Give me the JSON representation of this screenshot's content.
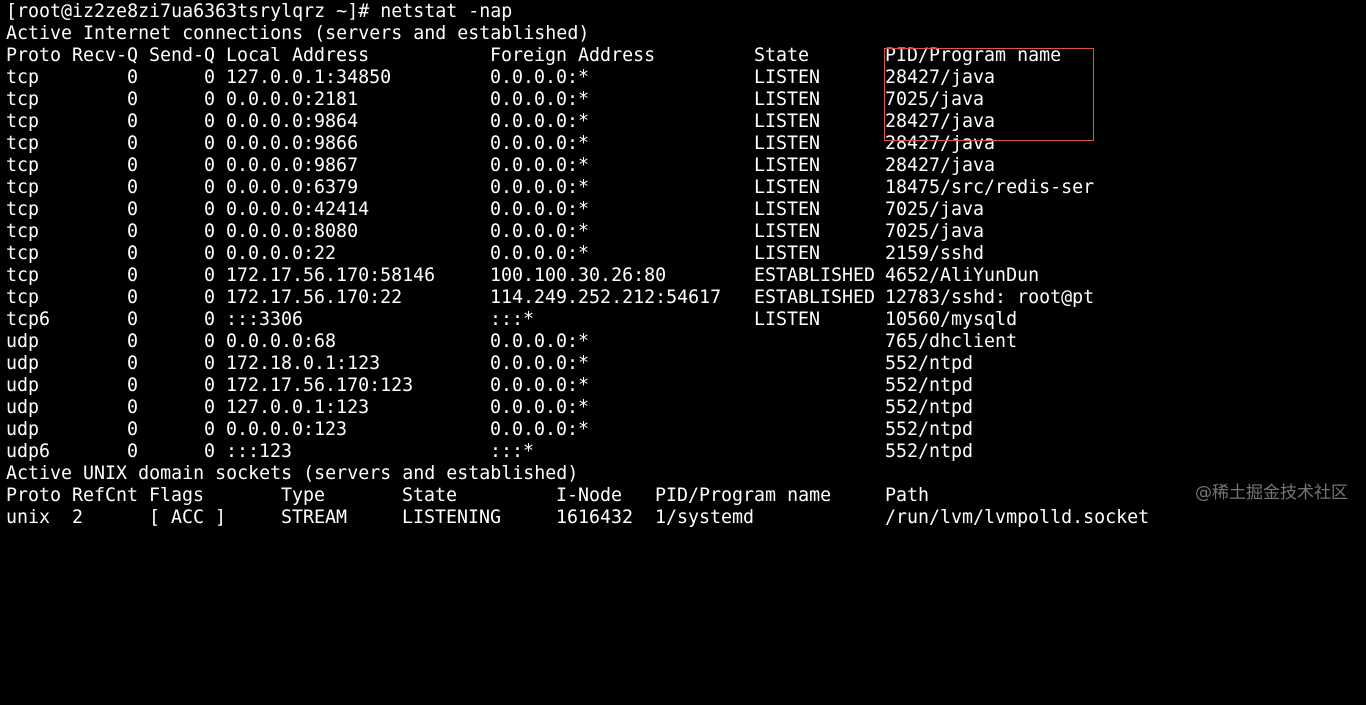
{
  "prompt": "[root@iz2ze8zi7ua6363tsrylqrz ~]# netstat -nap",
  "inet_section_title": "Active Internet connections (servers and established)",
  "inet_headers": {
    "proto": "Proto",
    "recvq": "Recv-Q",
    "sendq": "Send-Q",
    "local": "Local Address",
    "foreign": "Foreign Address",
    "state": "State",
    "pid": "PID/Program name"
  },
  "inet_rows": [
    {
      "proto": "tcp",
      "recvq": "0",
      "sendq": "0",
      "local": "127.0.0.1:34850",
      "foreign": "0.0.0.0:*",
      "state": "LISTEN",
      "pid": "28427/java"
    },
    {
      "proto": "tcp",
      "recvq": "0",
      "sendq": "0",
      "local": "0.0.0.0:2181",
      "foreign": "0.0.0.0:*",
      "state": "LISTEN",
      "pid": "7025/java"
    },
    {
      "proto": "tcp",
      "recvq": "0",
      "sendq": "0",
      "local": "0.0.0.0:9864",
      "foreign": "0.0.0.0:*",
      "state": "LISTEN",
      "pid": "28427/java"
    },
    {
      "proto": "tcp",
      "recvq": "0",
      "sendq": "0",
      "local": "0.0.0.0:9866",
      "foreign": "0.0.0.0:*",
      "state": "LISTEN",
      "pid": "28427/java"
    },
    {
      "proto": "tcp",
      "recvq": "0",
      "sendq": "0",
      "local": "0.0.0.0:9867",
      "foreign": "0.0.0.0:*",
      "state": "LISTEN",
      "pid": "28427/java"
    },
    {
      "proto": "tcp",
      "recvq": "0",
      "sendq": "0",
      "local": "0.0.0.0:6379",
      "foreign": "0.0.0.0:*",
      "state": "LISTEN",
      "pid": "18475/src/redis-ser"
    },
    {
      "proto": "tcp",
      "recvq": "0",
      "sendq": "0",
      "local": "0.0.0.0:42414",
      "foreign": "0.0.0.0:*",
      "state": "LISTEN",
      "pid": "7025/java"
    },
    {
      "proto": "tcp",
      "recvq": "0",
      "sendq": "0",
      "local": "0.0.0.0:8080",
      "foreign": "0.0.0.0:*",
      "state": "LISTEN",
      "pid": "7025/java"
    },
    {
      "proto": "tcp",
      "recvq": "0",
      "sendq": "0",
      "local": "0.0.0.0:22",
      "foreign": "0.0.0.0:*",
      "state": "LISTEN",
      "pid": "2159/sshd"
    },
    {
      "proto": "tcp",
      "recvq": "0",
      "sendq": "0",
      "local": "172.17.56.170:58146",
      "foreign": "100.100.30.26:80",
      "state": "ESTABLISHED",
      "pid": "4652/AliYunDun"
    },
    {
      "proto": "tcp",
      "recvq": "0",
      "sendq": "0",
      "local": "172.17.56.170:22",
      "foreign": "114.249.252.212:54617",
      "state": "ESTABLISHED",
      "pid": "12783/sshd: root@pt"
    },
    {
      "proto": "tcp6",
      "recvq": "0",
      "sendq": "0",
      "local": ":::3306",
      "foreign": ":::*",
      "state": "LISTEN",
      "pid": "10560/mysqld"
    },
    {
      "proto": "udp",
      "recvq": "0",
      "sendq": "0",
      "local": "0.0.0.0:68",
      "foreign": "0.0.0.0:*",
      "state": "",
      "pid": "765/dhclient"
    },
    {
      "proto": "udp",
      "recvq": "0",
      "sendq": "0",
      "local": "172.18.0.1:123",
      "foreign": "0.0.0.0:*",
      "state": "",
      "pid": "552/ntpd"
    },
    {
      "proto": "udp",
      "recvq": "0",
      "sendq": "0",
      "local": "172.17.56.170:123",
      "foreign": "0.0.0.0:*",
      "state": "",
      "pid": "552/ntpd"
    },
    {
      "proto": "udp",
      "recvq": "0",
      "sendq": "0",
      "local": "127.0.0.1:123",
      "foreign": "0.0.0.0:*",
      "state": "",
      "pid": "552/ntpd"
    },
    {
      "proto": "udp",
      "recvq": "0",
      "sendq": "0",
      "local": "0.0.0.0:123",
      "foreign": "0.0.0.0:*",
      "state": "",
      "pid": "552/ntpd"
    },
    {
      "proto": "udp6",
      "recvq": "0",
      "sendq": "0",
      "local": ":::123",
      "foreign": ":::*",
      "state": "",
      "pid": "552/ntpd"
    }
  ],
  "unix_section_title": "Active UNIX domain sockets (servers and established)",
  "unix_headers": {
    "proto": "Proto",
    "refcnt": "RefCnt",
    "flags": "Flags",
    "type": "Type",
    "state": "State",
    "inode": "I-Node",
    "pid": "PID/Program name",
    "path": "Path"
  },
  "unix_rows": [
    {
      "proto": "unix",
      "refcnt": "2",
      "flags": "[ ACC ]",
      "type": "STREAM",
      "state": "LISTENING",
      "inode": "1616432",
      "pid": "1/systemd",
      "path": "/run/lvm/lvmpolld.socket"
    }
  ],
  "watermark": "@稀土掘金技术社区",
  "colors": {
    "background": "#000000",
    "text": "#ffffff",
    "highlight_border": "#d9534f",
    "watermark": "#8a8a8a"
  }
}
